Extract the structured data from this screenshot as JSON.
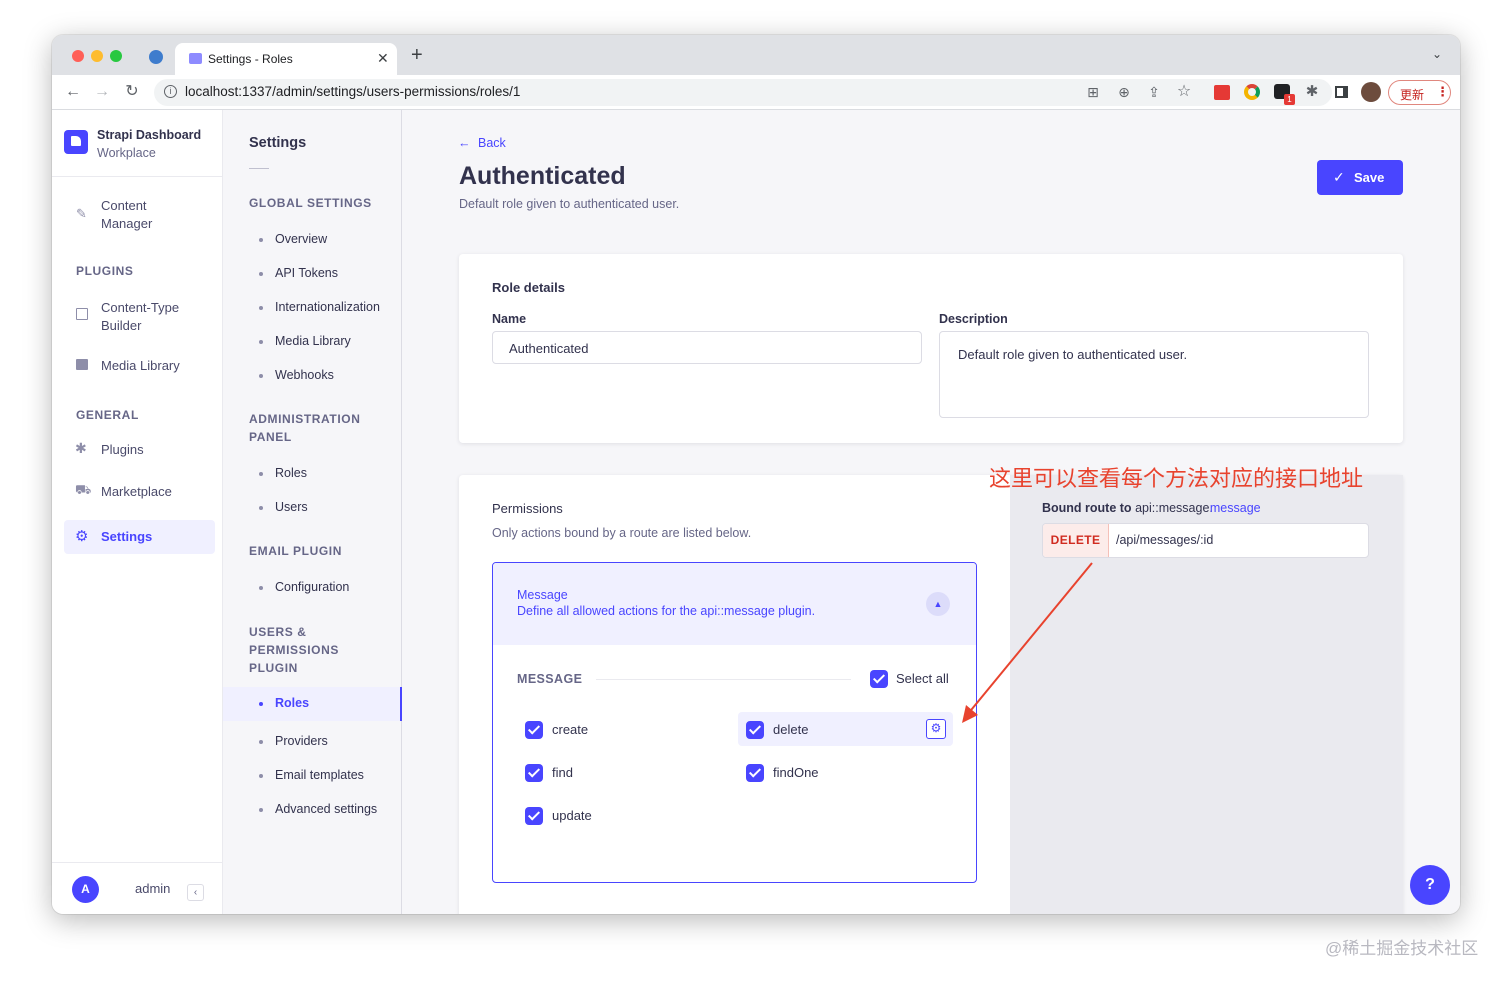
{
  "browser": {
    "tab_title": "Settings - Roles",
    "new_tab": "+",
    "url": "localhost:1337/admin/settings/users-permissions/roles/1",
    "update_label": "更新",
    "ext_badge": "1"
  },
  "sidebar": {
    "brand_title": "Strapi Dashboard",
    "brand_sub": "Workplace",
    "content_manager": [
      "Content",
      "Manager"
    ],
    "plugins_heading": "PLUGINS",
    "content_type_builder": [
      "Content-Type",
      "Builder"
    ],
    "media_library": "Media Library",
    "general_heading": "GENERAL",
    "plugins": "Plugins",
    "marketplace": "Marketplace",
    "settings": "Settings",
    "avatar_letter": "A",
    "user": "admin"
  },
  "subnav": {
    "title": "Settings",
    "global_heading": "GLOBAL SETTINGS",
    "global_items": [
      "Overview",
      "API Tokens",
      "Internationalization",
      "Media Library",
      "Webhooks"
    ],
    "admin_heading": [
      "ADMINISTRATION",
      "PANEL"
    ],
    "admin_items": [
      "Roles",
      "Users"
    ],
    "email_heading": "EMAIL PLUGIN",
    "email_items": [
      "Configuration"
    ],
    "up_heading": [
      "USERS &",
      "PERMISSIONS",
      "PLUGIN"
    ],
    "up_items": [
      "Roles",
      "Providers",
      "Email templates",
      "Advanced settings"
    ]
  },
  "header": {
    "back": "Back",
    "title": "Authenticated",
    "subtitle": "Default role given to authenticated user.",
    "save": "Save"
  },
  "role_details": {
    "heading": "Role details",
    "name_label": "Name",
    "name_value": "Authenticated",
    "description_label": "Description",
    "description_value": "Default role given to authenticated user."
  },
  "permissions": {
    "heading": "Permissions",
    "subtitle": "Only actions bound by a route are listed below.",
    "accordion_title": "Message",
    "accordion_desc": "Define all allowed actions for the api::message plugin.",
    "group_label": "MESSAGE",
    "select_all": "Select all",
    "actions": [
      "create",
      "delete",
      "find",
      "findOne",
      "update"
    ]
  },
  "bound_route": {
    "label_prefix": "Bound route to",
    "api": "api::message.",
    "controller": "message",
    "method": "DELETE",
    "path": "/api/messages/:id"
  },
  "annotation": "这里可以查看每个方法对应的接口地址",
  "help": "?",
  "watermark": "@稀土掘金技术社区",
  "colors": {
    "primary": "#4945ff",
    "danger": "#d02b20",
    "annotation": "#e8432e"
  }
}
